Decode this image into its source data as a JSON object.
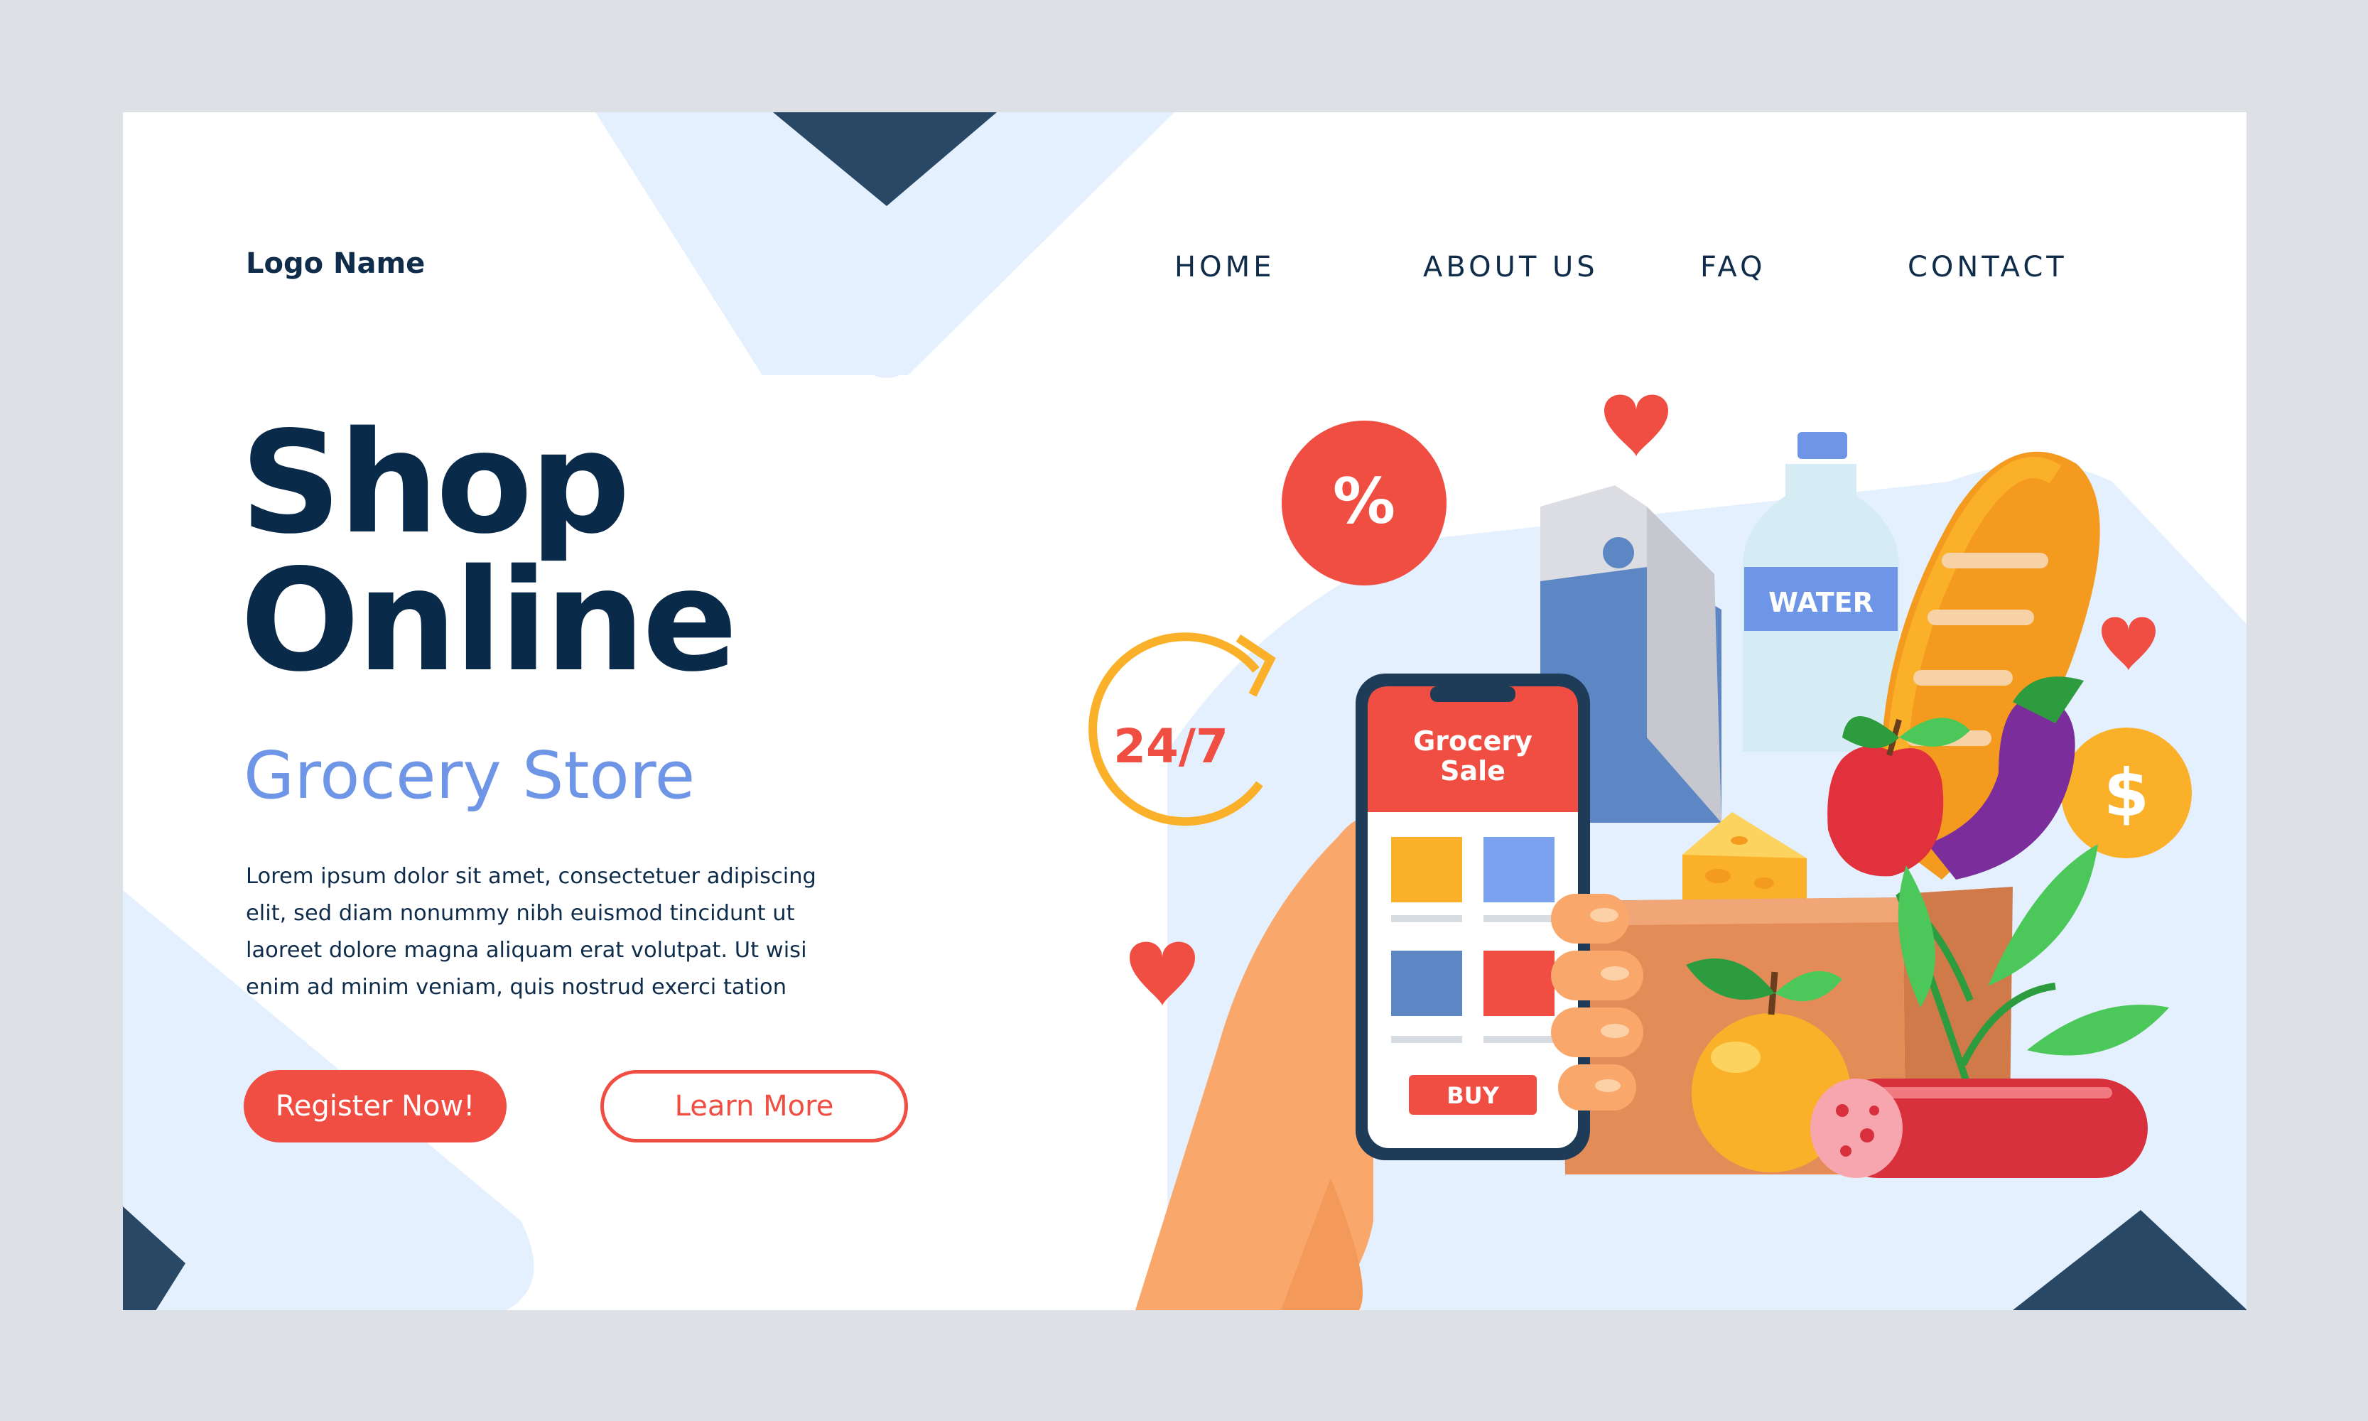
{
  "header": {
    "logo": "Logo Name",
    "nav": [
      {
        "label": "HOME"
      },
      {
        "label": "ABOUT US"
      },
      {
        "label": "FAQ"
      },
      {
        "label": "CONTACT"
      }
    ]
  },
  "hero": {
    "title_line1": "Shop",
    "title_line2": "Online",
    "subtitle": "Grocery Store",
    "body_lines": [
      "Lorem ipsum dolor sit amet, consectetuer adipiscing",
      "elit, sed diam nonummy nibh euismod tincidunt ut",
      "laoreet dolore magna aliquam erat volutpat. Ut wisi",
      "enim ad minim  veniam, quis nostrud exerci tation"
    ],
    "primary_button": "Register Now!",
    "secondary_button": "Learn More"
  },
  "illustration": {
    "discount_symbol": "%",
    "availability": "24/7",
    "currency_symbol": "$",
    "phone_screen_title_line1": "Grocery",
    "phone_screen_title_line2": "Sale",
    "phone_buy_label": "BUY",
    "bottle_label": "WATER"
  },
  "colors": {
    "navy": "#0f2c4a",
    "accent_red": "#f04e43",
    "accent_blue": "#6f96e6",
    "light_blue_bg": "#e4f0fd",
    "dark_triangle": "#284866",
    "outer_frame": "#dde1e5"
  }
}
